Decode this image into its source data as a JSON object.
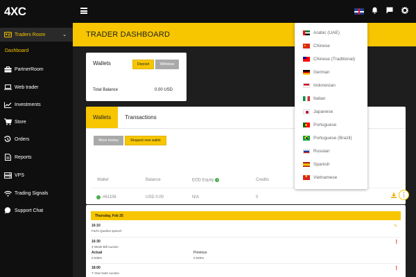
{
  "brand": {
    "logo": "4XC"
  },
  "sidebar": {
    "items": [
      {
        "label": "Traders Room",
        "icon": "id-card-icon"
      },
      {
        "label": "PartnerRoom",
        "icon": "briefcase-icon"
      },
      {
        "label": "Web trader",
        "icon": "laptop-icon"
      },
      {
        "label": "Investments",
        "icon": "chart-line-icon"
      },
      {
        "label": "Store",
        "icon": "cart-icon"
      },
      {
        "label": "Orders",
        "icon": "history-icon"
      },
      {
        "label": "Reports",
        "icon": "document-icon"
      },
      {
        "label": "VPS",
        "icon": "server-icon"
      },
      {
        "label": "Trading Signals",
        "icon": "wifi-icon"
      },
      {
        "label": "Support Chat",
        "icon": "chat-bubble-icon"
      }
    ],
    "sub_item": "Dashboard"
  },
  "page": {
    "title": "TRADER DASHBOARD"
  },
  "wallets": {
    "title": "Wallets",
    "deposit": "Deposit",
    "withdraw": "Withdraw",
    "balance_label": "Total Balance",
    "balance_value": "0.00 USD"
  },
  "tabs": {
    "wallets": "Wallets",
    "transactions": "Transactions"
  },
  "wallet_actions": {
    "move": "Move money",
    "request": "Request new wallet"
  },
  "table": {
    "headers": [
      "Wallet",
      "Balance",
      "EOD Equity",
      "Credits"
    ],
    "row": {
      "wallet": "#61106",
      "balance": "USD 0.00",
      "eod": "N/A",
      "credits": "0"
    }
  },
  "calendar": {
    "date": "Thursday, Feb 25",
    "events": [
      {
        "time": "16:10",
        "name": "Fed's Quarles speech"
      },
      {
        "time": "16:30",
        "name": "4-Week Bill Auction",
        "actual_label": "Actual",
        "actual": "0.035%",
        "previous_label": "Previous",
        "previous": "0.025%"
      },
      {
        "time": "18:00",
        "name": "7-Year Note Auction"
      }
    ]
  },
  "languages": [
    "Arabic (UAE)",
    "Chinese",
    "Chinese (Traditional)",
    "German",
    "Indonesian",
    "Italian",
    "Japanese",
    "Portuguese",
    "Portuguese (Brazil)",
    "Russian",
    "Spanish",
    "Vietnamese"
  ],
  "colors": {
    "accent": "#f7c600",
    "dark": "#0f0f0f",
    "success": "#4caf50"
  }
}
